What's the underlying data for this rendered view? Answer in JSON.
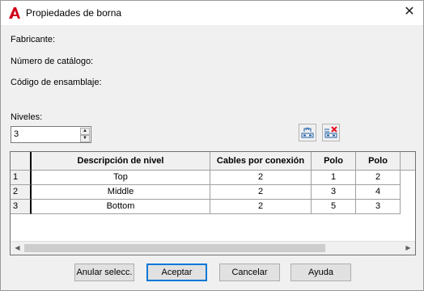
{
  "window": {
    "title": "Propiedades de borna"
  },
  "fields": {
    "fabricante": "Fabricante:",
    "catalogo": "Número de catálogo:",
    "ensamblaje": "Código de ensamblaje:"
  },
  "niveles": {
    "label": "Niveles:",
    "value": "3"
  },
  "grid": {
    "headers": [
      "Descripción de nivel",
      "Cables por conexión",
      "Polo",
      "Polo"
    ],
    "rows": [
      {
        "num": "1",
        "desc": "Top",
        "cables": "2",
        "polo1": "1",
        "polo2": "2"
      },
      {
        "num": "2",
        "desc": "Middle",
        "cables": "2",
        "polo1": "3",
        "polo2": "4"
      },
      {
        "num": "3",
        "desc": "Bottom",
        "cables": "2",
        "polo1": "5",
        "polo2": "3"
      }
    ]
  },
  "buttons": {
    "anular": "Anular selecc.",
    "aceptar": "Aceptar",
    "cancelar": "Cancelar",
    "ayuda": "Ayuda"
  },
  "icons": {
    "app": "autocad-a-icon",
    "close": "close-icon",
    "add_level": "add-level-icon",
    "delete_level": "delete-level-icon"
  },
  "colors": {
    "app_icon": "#d0021b",
    "delete_x": "#e81123",
    "default_button_border": "#0078d7"
  }
}
